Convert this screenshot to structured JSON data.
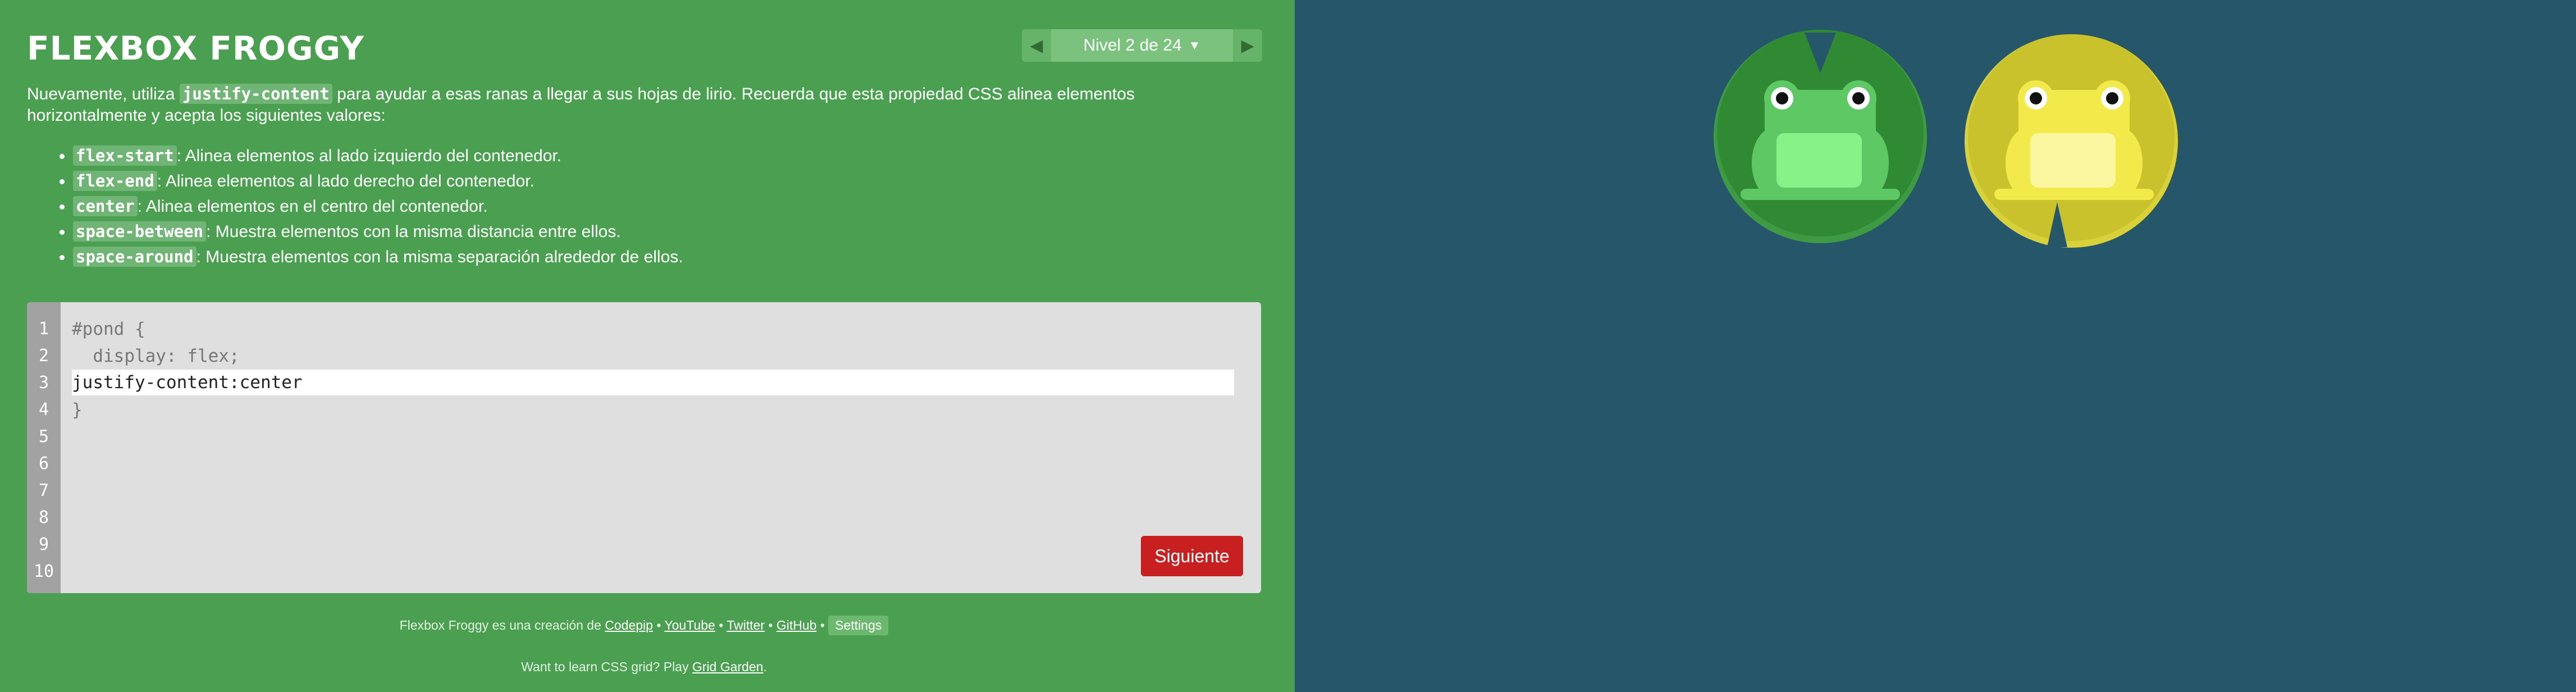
{
  "header": {
    "title": "FLEXBOX FROGGY",
    "level_label": "Nivel 2 de 24"
  },
  "instructions": {
    "intro_pre": "Nuevamente, utiliza",
    "intro_keyword": "justify-content",
    "intro_post": "para ayudar a esas ranas a llegar a sus hojas de lirio. Recuerda que esta propiedad CSS alinea elementos horizontalmente y acepta los siguientes valores:",
    "values": [
      {
        "keyword": "flex-start",
        "desc": ": Alinea elementos al lado izquierdo del contenedor."
      },
      {
        "keyword": "flex-end",
        "desc": ": Alinea elementos al lado derecho del contenedor."
      },
      {
        "keyword": "center",
        "desc": ": Alinea elementos en el centro del contenedor."
      },
      {
        "keyword": "space-between",
        "desc": ": Muestra elementos con la misma distancia entre ellos."
      },
      {
        "keyword": "space-around",
        "desc": ": Muestra elementos con la misma separación alrededor de ellos."
      }
    ]
  },
  "editor": {
    "line_numbers": [
      "1",
      "2",
      "3",
      "4",
      "5",
      "6",
      "7",
      "8",
      "9",
      "10"
    ],
    "line1": "#pond {",
    "line2": "  display: flex;",
    "input_value": "justify-content:center",
    "line4": "}",
    "next_label": "Siguiente"
  },
  "footer": {
    "credit_pre": "Flexbox Froggy es una creación de",
    "codepip": "Codepip",
    "youtube": "YouTube",
    "twitter": "Twitter",
    "github": "GitHub",
    "settings": "Settings",
    "sep": "•",
    "promo_pre": "Want to learn CSS grid? Play",
    "promo_link": "Grid Garden",
    "promo_post": "."
  },
  "pond": {
    "frogs": [
      {
        "color": "green",
        "body": "#5ec964",
        "belly": "#87f287",
        "pad": "#2f8a33",
        "pad_rim": "#3f9a44"
      },
      {
        "color": "yellow",
        "body": "#f2e94a",
        "belly": "#fbf6a0",
        "pad": "#c9c22c",
        "pad_rim": "#d8d13a"
      }
    ]
  },
  "colors": {
    "sidebar": "#4aa050",
    "board": "#25566a",
    "next_button": "#c82020"
  }
}
